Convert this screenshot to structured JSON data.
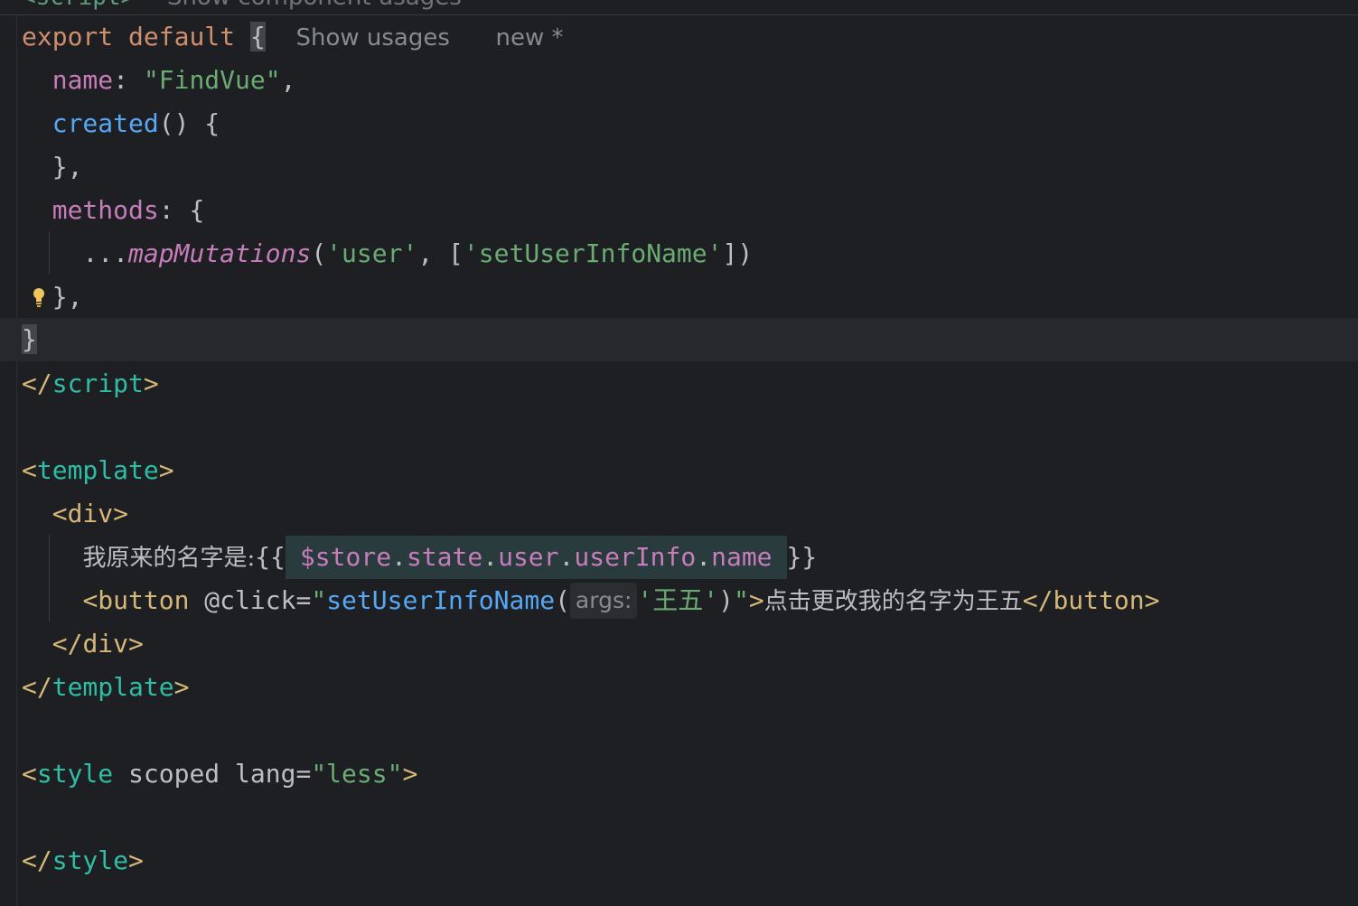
{
  "topbar": {
    "crumb": "<script>",
    "hint": "Show component usages"
  },
  "code": {
    "l1": {
      "kw1": "export",
      "kw2": "default",
      "brace": "{",
      "hint1": "Show usages",
      "hint2": "new *"
    },
    "l2": {
      "prop": "name",
      "punct": ": ",
      "str": "\"FindVue\"",
      "end": ","
    },
    "l3": {
      "fn": "created",
      "rest": "() {"
    },
    "l4": {
      "text": "},"
    },
    "l5": {
      "prop": "methods",
      "rest": ": {"
    },
    "l6": {
      "spread": "...",
      "fn": "mapMutations",
      "open": "(",
      "s1": "'user'",
      "mid": ", [",
      "s2": "'setUserInfoName'",
      "close": "])"
    },
    "l7": {
      "text": "},"
    },
    "l8": {
      "text": "}"
    },
    "l9": {
      "open": "</",
      "name": "script",
      "close": ">"
    },
    "l11": {
      "open": "<",
      "name": "template",
      "close": ">"
    },
    "l12": {
      "open": "<",
      "name": "div",
      "close": ">"
    },
    "l13": {
      "cjk": "我原来的名字是:",
      "open": "{{",
      "var": "$store",
      "d1": ".",
      "p1": "state",
      "d2": ".",
      "p2": "user",
      "d3": ".",
      "p3": "userInfo",
      "d4": ".",
      "p4": "name",
      "close": "}}"
    },
    "l14": {
      "open": "<",
      "name": "button",
      "attr": " @click",
      "eq": "=",
      "q1": "\"",
      "fn": "setUserInfoName",
      "paren": "(",
      "hint": "args:",
      "s": "'王五'",
      "paren2": ")",
      "q2": "\"",
      "gt": ">",
      "cjk": "点击更改我的名字为王五",
      "endopen": "</",
      "endname": "button",
      "endclose": ">"
    },
    "l15": {
      "open": "</",
      "name": "div",
      "close": ">"
    },
    "l16": {
      "open": "</",
      "name": "template",
      "close": ">"
    },
    "l18": {
      "open": "<",
      "name": "style",
      "attr1": " scoped",
      "attr2": " lang",
      "eq": "=",
      "str": "\"less\"",
      "close": ">"
    },
    "l20": {
      "open": "</",
      "name": "style",
      "close": ">"
    }
  },
  "colors": {
    "background": "#1e1f22",
    "keyword": "#cf8e6d",
    "property": "#c77dbb",
    "string": "#6aab73",
    "function": "#56a8f5",
    "tag": "#d5b778",
    "tagname": "#2fbda5"
  },
  "icons": {
    "intention": "lightbulb-icon"
  }
}
